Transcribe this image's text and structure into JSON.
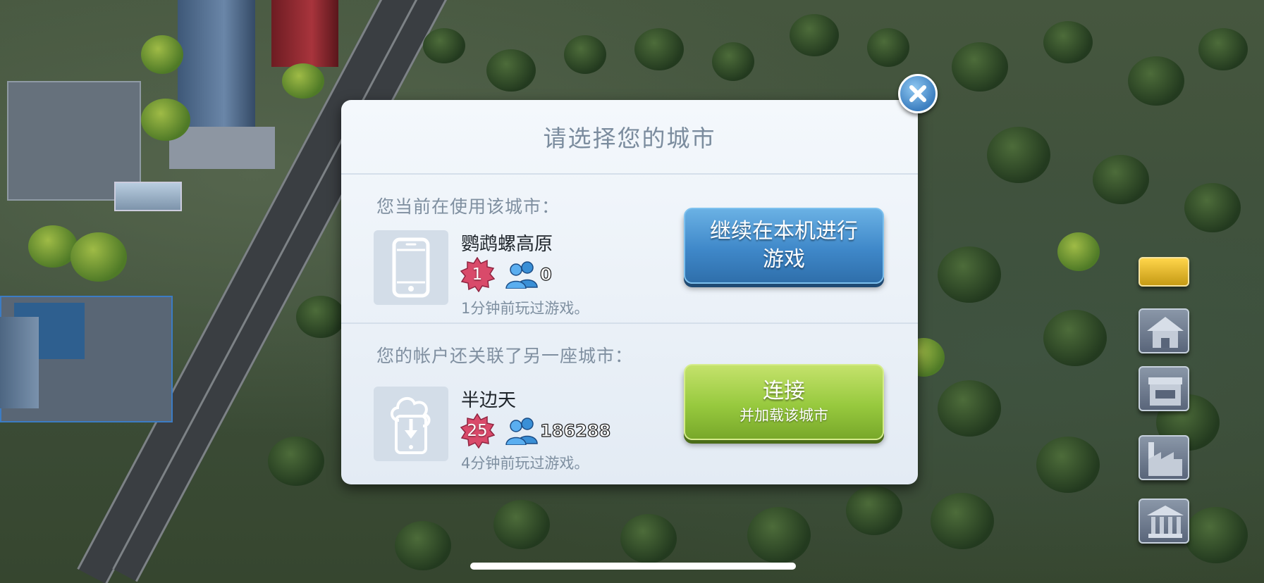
{
  "dialog": {
    "title": "请选择您的城市",
    "current_city": {
      "heading": "您当前在使用该城市：",
      "device_icon": "phone-icon",
      "name": "鹦鹉螺高原",
      "level": "1",
      "population": "0",
      "last_played": "1分钟前玩过游戏。",
      "button_label": "继续在本机进行游戏",
      "button_color": "#3f88c9"
    },
    "linked_city": {
      "heading": "您的帐户还关联了另一座城市：",
      "device_icon": "cloud-download-phone-icon",
      "name": "半边天",
      "level": "25",
      "population": "186288",
      "last_played": "4分钟前玩过游戏。",
      "button_label": "连接",
      "button_sublabel": "并加载该城市",
      "button_color": "#97c93e"
    },
    "close_icon": "close-icon"
  },
  "colors": {
    "level_badge": "#d94a6a",
    "population_icon": "#3a8fd6"
  },
  "side_toolbar": {
    "icons": [
      "road-tool-icon",
      "residential-zone-icon",
      "commercial-shop-icon",
      "factory-icon",
      "government-building-icon"
    ]
  }
}
